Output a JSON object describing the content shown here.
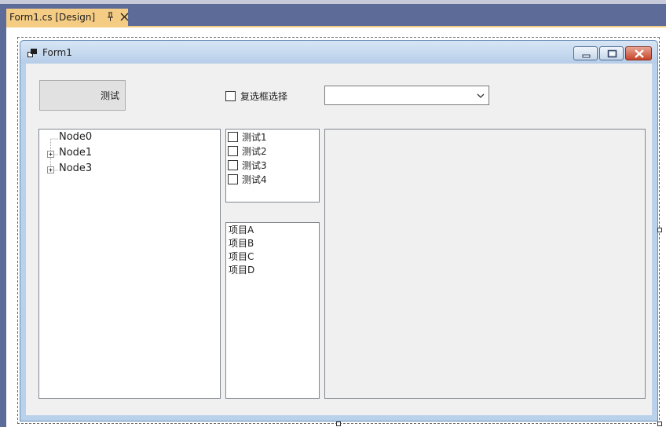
{
  "document_tab": {
    "title": "Form1.cs [Design]",
    "pin_icon": "pin-icon",
    "close_icon": "close-icon"
  },
  "form": {
    "title": "Form1",
    "icon": "form-icon",
    "minimize_icon": "minimize-icon",
    "maximize_icon": "maximize-icon",
    "close_icon": "close-icon"
  },
  "controls": {
    "button_label": "测试",
    "checkbox_label": "复选框选择",
    "combo_value": "",
    "tree_nodes": [
      {
        "label": "Node0",
        "expandable": false
      },
      {
        "label": "Node1",
        "expandable": true
      },
      {
        "label": "Node3",
        "expandable": true
      }
    ],
    "checked_list_items": [
      "测试1",
      "测试2",
      "测试3",
      "测试4"
    ],
    "list_items": [
      "项目A",
      "项目B",
      "项目C",
      "项目D"
    ]
  },
  "colors": {
    "ide_background": "#5d6b99",
    "tab_accent": "#f5cc84",
    "form_background": "#f0f0f0",
    "window_frame": "#b9d1ea",
    "close_button": "#c6452a"
  }
}
